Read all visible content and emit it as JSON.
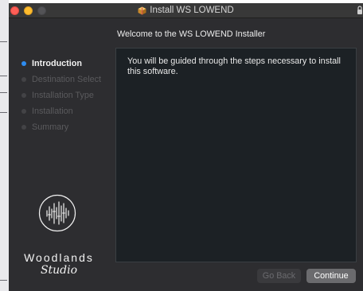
{
  "window": {
    "title": "Install WS LOWEND",
    "title_icon": "package-icon",
    "lock_icon": "lock-icon"
  },
  "header": {
    "subtitle": "Welcome to the WS LOWEND Installer"
  },
  "sidebar": {
    "steps": [
      {
        "label": "Introduction",
        "active": true
      },
      {
        "label": "Destination Select",
        "active": false
      },
      {
        "label": "Installation Type",
        "active": false
      },
      {
        "label": "Installation",
        "active": false
      },
      {
        "label": "Summary",
        "active": false
      }
    ]
  },
  "content": {
    "text": "You will be guided through the steps necessary to install this software."
  },
  "branding": {
    "name": "Woodlands",
    "subname": "Studio"
  },
  "buttons": {
    "back_label": "Go Back",
    "continue_label": "Continue"
  },
  "colors": {
    "accent": "#2e8cf0",
    "close": "#fd5f57",
    "minimize": "#febc2e",
    "window_bg": "#2d2d30",
    "content_bg": "#1c2125"
  }
}
